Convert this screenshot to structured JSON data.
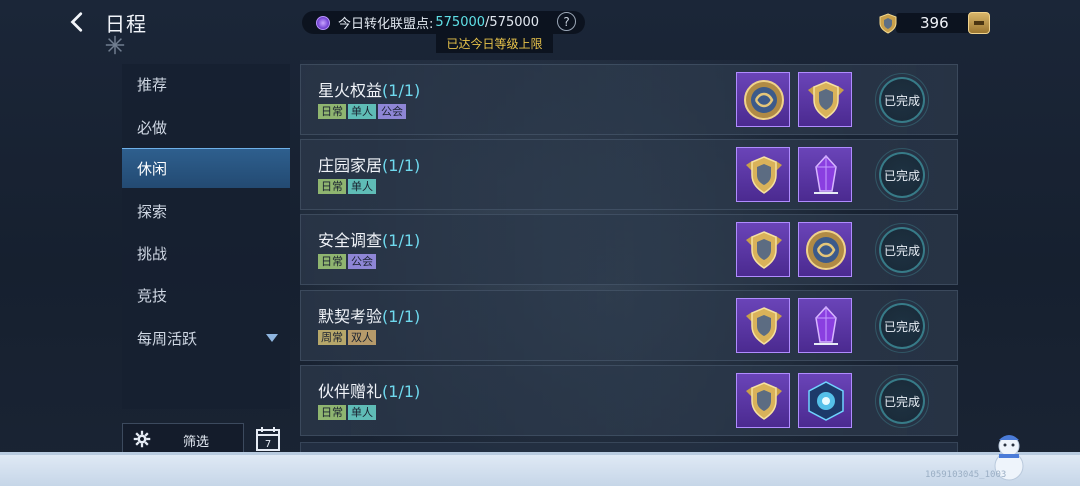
{
  "header": {
    "title": "日程",
    "points_label": "今日转化联盟点:",
    "points_current": "575000",
    "points_separator": "/",
    "points_max": "575000",
    "help": "?",
    "limit_notice": "已达今日等级上限",
    "badge_count": "396"
  },
  "sidebar": {
    "items": [
      {
        "label": "推荐"
      },
      {
        "label": "必做"
      },
      {
        "label": "休闲",
        "active": true
      },
      {
        "label": "探索"
      },
      {
        "label": "挑战"
      },
      {
        "label": "竞技"
      },
      {
        "label": "每周活跃"
      }
    ],
    "filter_label": "筛选",
    "calendar_day": "7"
  },
  "tasks": [
    {
      "name": "星火权益",
      "count": "1/1",
      "tags": [
        "日常",
        "单人",
        "公会"
      ],
      "rewards": [
        "coin-icon",
        "badge-icon"
      ],
      "status": "已完成"
    },
    {
      "name": "庄园家居",
      "count": "1/1",
      "tags": [
        "日常",
        "单人"
      ],
      "rewards": [
        "badge-icon",
        "crystal-icon"
      ],
      "status": "已完成"
    },
    {
      "name": "安全调查",
      "count": "1/1",
      "tags": [
        "日常",
        "公会"
      ],
      "rewards": [
        "badge-icon",
        "coin-icon"
      ],
      "status": "已完成"
    },
    {
      "name": "默契考验",
      "count": "1/1",
      "tags": [
        "周常",
        "双人"
      ],
      "rewards": [
        "badge-icon",
        "crystal-icon"
      ],
      "status": "已完成"
    },
    {
      "name": "伙伴赠礼",
      "count": "1/1",
      "tags": [
        "日常",
        "单人"
      ],
      "rewards": [
        "badge-icon",
        "orb-icon"
      ],
      "status": "已完成"
    }
  ],
  "footer": {
    "build_id": "1059103045_1003"
  },
  "colors": {
    "accent_cyan": "#5fe0e6",
    "limit_yellow": "#e8c34a",
    "reward_purple": "#5a36a4",
    "active_tab": "#2e5f8e"
  }
}
